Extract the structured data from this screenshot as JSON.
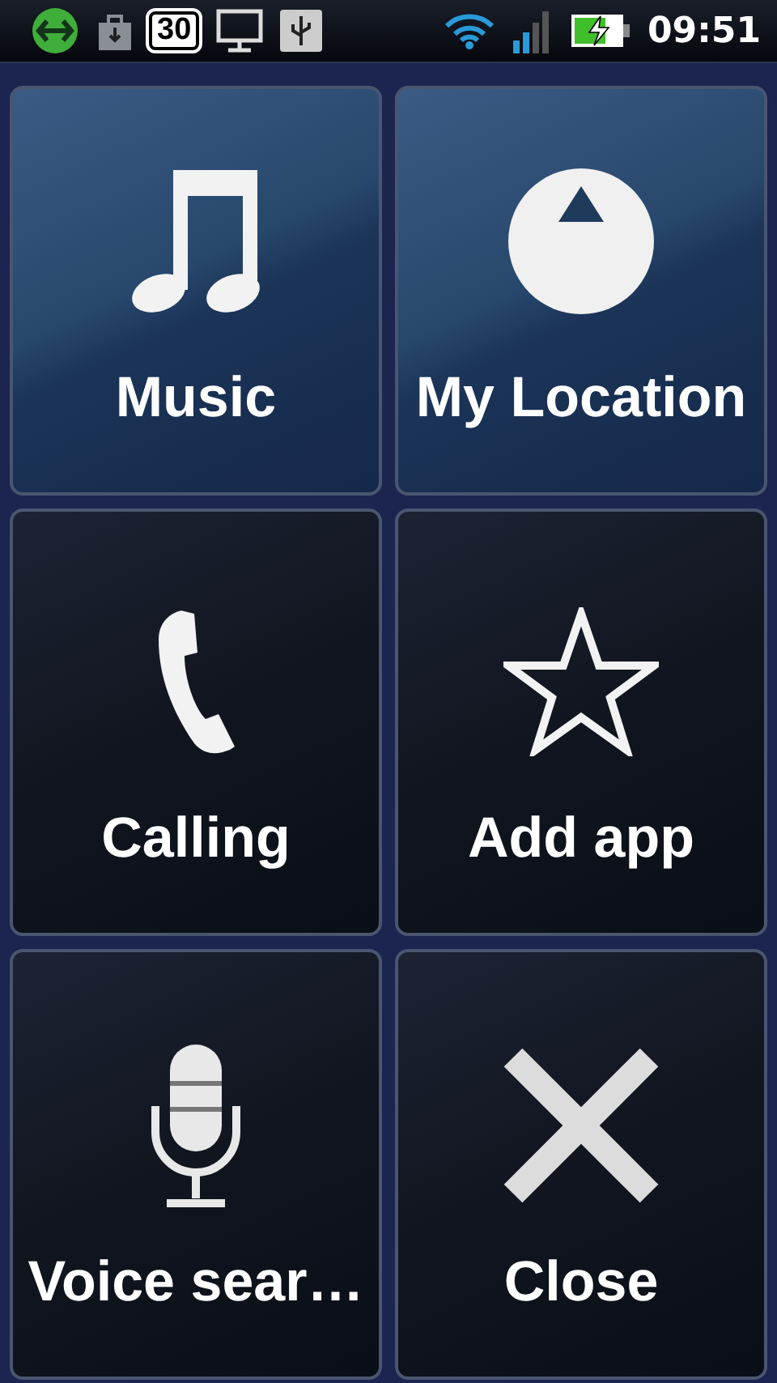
{
  "status_bar": {
    "badge": "30",
    "time": "09:51"
  },
  "tiles": [
    {
      "label": "Music",
      "selected": true
    },
    {
      "label": "My Location",
      "selected": true
    },
    {
      "label": "Calling",
      "selected": false
    },
    {
      "label": "Add app",
      "selected": false
    },
    {
      "label": "Voice sear…",
      "selected": false
    },
    {
      "label": "Close",
      "selected": false
    }
  ]
}
